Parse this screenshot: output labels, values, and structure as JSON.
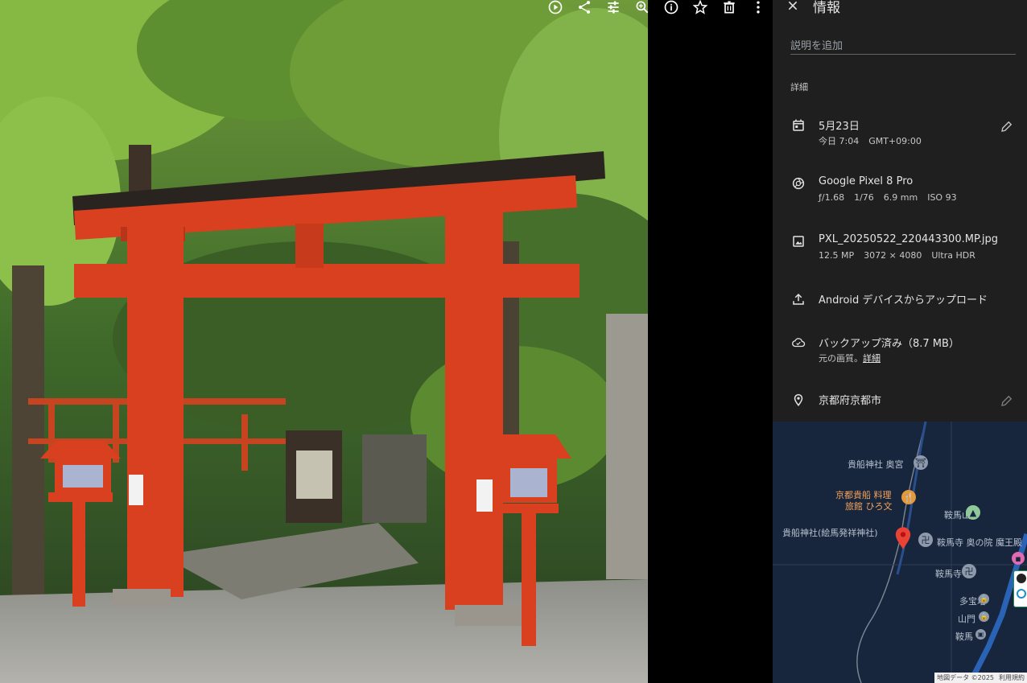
{
  "toolbar": {
    "icons": [
      "slideshow-icon",
      "share-icon",
      "edit-icon",
      "zoom-icon",
      "info-icon",
      "star-icon",
      "delete-icon",
      "more-icon"
    ]
  },
  "panel": {
    "title": "情報",
    "description_placeholder": "説明を追加",
    "section_label": "詳細",
    "date": {
      "title": "5月23日",
      "time": "今日 7:04",
      "tz": "GMT+09:00"
    },
    "camera": {
      "model": "Google Pixel 8 Pro",
      "aperture": "ƒ/1.68",
      "shutter": "1/76",
      "focal": "6.9 mm",
      "iso": "ISO 93"
    },
    "file": {
      "name": "PXL_20250522_220443300.MP.jpg",
      "mp": "12.5 MP",
      "dims": "3072 × 4080",
      "hdr": "Ultra HDR"
    },
    "upload": {
      "text": "Android デバイスからアップロード"
    },
    "backup": {
      "title": "バックアップ済み（8.7 MB）",
      "quality": "元の画質。",
      "details": "詳細"
    },
    "location": {
      "text": "京都府京都市"
    }
  },
  "map": {
    "labels": {
      "okumiya": "貴船神社 奥宮",
      "ryokan1": "京都貴船 料理",
      "ryokan2": "旅館 ひろ文",
      "kuramayama": "鞍馬山",
      "kibune": "貴船神社(絵馬発祥神社)",
      "okunoin": "鞍馬寺 奥の院 魔王殿",
      "kuramadera": "鞍馬寺",
      "tahoto": "多宝塔",
      "sanmon": "山門",
      "kurama": "鞍馬"
    },
    "attribution": "地図データ ©2025",
    "terms": "利用規約"
  },
  "colors": {
    "torii": "#d8401f",
    "panel": "#1f1f1f",
    "map": "#17263c",
    "pin": "#ea4335"
  }
}
